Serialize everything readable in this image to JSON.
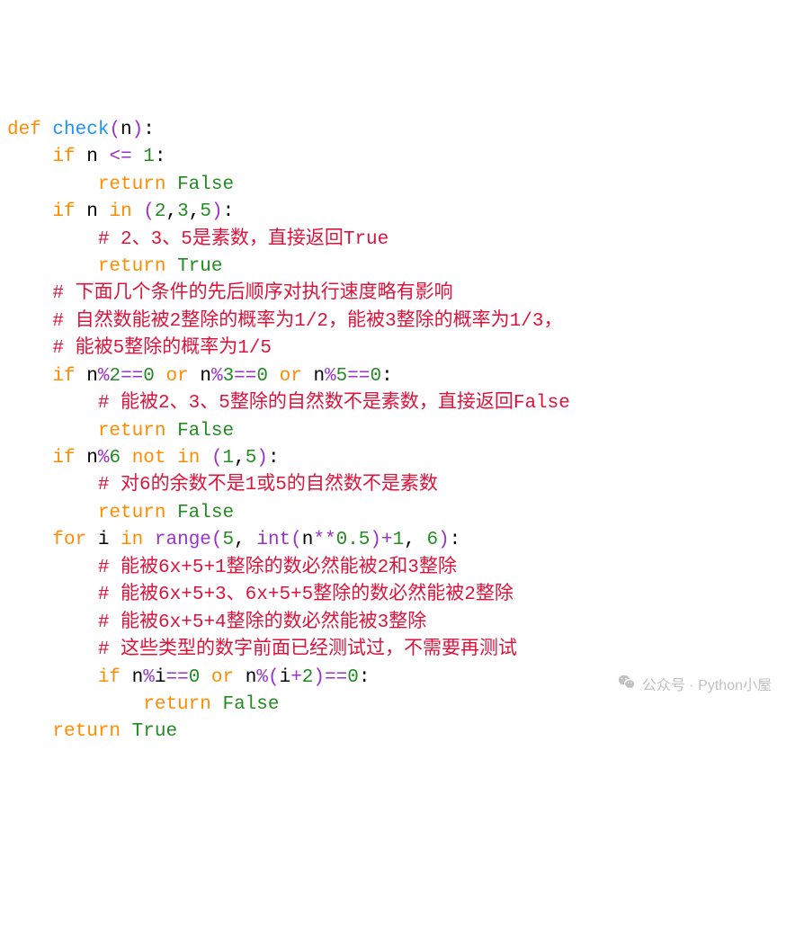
{
  "code": {
    "l1": {
      "def": "def",
      "fn": "check",
      "lp": "(",
      "n": "n",
      "rp": ")",
      "colon": ":"
    },
    "l2": {
      "if": "if",
      "n": "n",
      "op": "<=",
      "one": "1",
      "colon": ":"
    },
    "l3": {
      "ret": "return",
      "false": "False"
    },
    "l4": {
      "if": "if",
      "n": "n",
      "in": "in",
      "lp": "(",
      "v1": "2",
      "c1": ",",
      "v2": "3",
      "c2": ",",
      "v3": "5",
      "rp": ")",
      "colon": ":"
    },
    "l5": {
      "cmt": "# 2、3、5是素数，直接返回True"
    },
    "l6": {
      "ret": "return",
      "true": "True"
    },
    "l7": {
      "cmt": "# 下面几个条件的先后顺序对执行速度略有影响"
    },
    "l8": {
      "cmt": "# 自然数能被2整除的概率为1/2，能被3整除的概率为1/3，"
    },
    "l9": {
      "cmt": "# 能被5整除的概率为1/5"
    },
    "l10": {
      "if": "if",
      "e1a": "n",
      "e1op": "%",
      "e1b": "2",
      "eq1": "==",
      "e1c": "0",
      "or1": "or",
      "e2a": "n",
      "e2op": "%",
      "e2b": "3",
      "eq2": "==",
      "e2c": "0",
      "or2": "or",
      "e3a": "n",
      "e3op": "%",
      "e3b": "5",
      "eq3": "==",
      "e3c": "0",
      "colon": ":"
    },
    "l11": {
      "cmt": "# 能被2、3、5整除的自然数不是素数，直接返回False"
    },
    "l12": {
      "ret": "return",
      "false": "False"
    },
    "l13": {
      "if": "if",
      "n": "n",
      "mod": "%",
      "six": "6",
      "not": "not",
      "in": "in",
      "lp": "(",
      "v1": "1",
      "c1": ",",
      "v2": "5",
      "rp": ")",
      "colon": ":"
    },
    "l14": {
      "cmt": "# 对6的余数不是1或5的自然数不是素数"
    },
    "l15": {
      "ret": "return",
      "false": "False"
    },
    "l16": {
      "for": "for",
      "i": "i",
      "in": "in",
      "range": "range",
      "lp": "(",
      "five": "5",
      "c1": ",",
      "int": "int",
      "lp2": "(",
      "n": "n",
      "pow": "**",
      "half": "0.5",
      "rp2": ")",
      "plus": "+",
      "one": "1",
      "c2": ",",
      "six": "6",
      "rp": ")",
      "colon": ":"
    },
    "l17": {
      "cmt": "# 能被6x+5+1整除的数必然能被2和3整除"
    },
    "l18": {
      "cmt": "# 能被6x+5+3、6x+5+5整除的数必然能被2整除"
    },
    "l19": {
      "cmt": "# 能被6x+5+4整除的数必然能被3整除"
    },
    "l20": {
      "cmt": "# 这些类型的数字前面已经测试过，不需要再测试"
    },
    "l21": {
      "if": "if",
      "n1": "n",
      "mod1": "%",
      "i1": "i",
      "eq1": "==",
      "z1": "0",
      "or": "or",
      "n2": "n",
      "mod2": "%",
      "lp": "(",
      "i2": "i",
      "plus": "+",
      "two": "2",
      "rp": ")",
      "eq2": "==",
      "z2": "0",
      "colon": ":"
    },
    "l22": {
      "ret": "return",
      "false": "False"
    },
    "l23": {
      "ret": "return",
      "true": "True"
    }
  },
  "watermark": {
    "text": "公众号 · Python小屋"
  }
}
